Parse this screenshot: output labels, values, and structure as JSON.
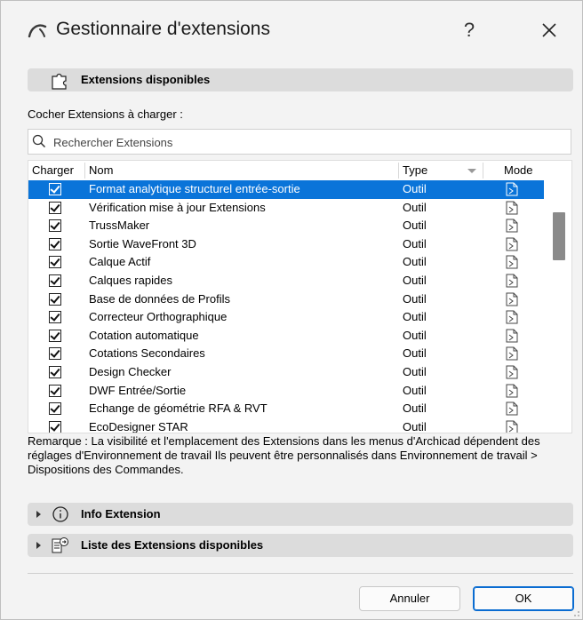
{
  "window": {
    "title": "Gestionnaire d'extensions",
    "help_label": "?",
    "title_icon": "archicad-logo-icon",
    "close_icon": "close-icon"
  },
  "available_section": {
    "label": "Extensions disponibles",
    "icon": "puzzle-piece-icon"
  },
  "prompt": "Cocher Extensions à charger :",
  "search": {
    "placeholder": "Rechercher Extensions",
    "value": "",
    "icon": "search-icon"
  },
  "table": {
    "columns": [
      "Charger",
      "Nom",
      "Type",
      "Mode"
    ],
    "rows": [
      {
        "checked": true,
        "name": "Format analytique structurel entrée-sortie",
        "type": "Outil",
        "selected": true
      },
      {
        "checked": true,
        "name": "Vérification mise à jour Extensions",
        "type": "Outil"
      },
      {
        "checked": true,
        "name": "TrussMaker",
        "type": "Outil"
      },
      {
        "checked": true,
        "name": "Sortie WaveFront 3D",
        "type": "Outil"
      },
      {
        "checked": true,
        "name": "Calque Actif",
        "type": "Outil"
      },
      {
        "checked": true,
        "name": "Calques rapides",
        "type": "Outil"
      },
      {
        "checked": true,
        "name": "Base de données de Profils",
        "type": "Outil"
      },
      {
        "checked": true,
        "name": "Correcteur Orthographique",
        "type": "Outil"
      },
      {
        "checked": true,
        "name": "Cotation automatique",
        "type": "Outil"
      },
      {
        "checked": true,
        "name": "Cotations Secondaires",
        "type": "Outil"
      },
      {
        "checked": true,
        "name": "Design Checker",
        "type": "Outil"
      },
      {
        "checked": true,
        "name": "DWF Entrée/Sortie",
        "type": "Outil"
      },
      {
        "checked": true,
        "name": "Echange de géométrie RFA & RVT",
        "type": "Outil"
      },
      {
        "checked": true,
        "name": "EcoDesigner STAR",
        "type": "Outil"
      }
    ],
    "mode_icon": "document-arrow-icon",
    "selection_color": "#0a74d9"
  },
  "remark": "Remarque : La visibilité et l'emplacement des Extensions dans les menus d'Archicad dépendent des réglages d'Environnement de travail Ils peuvent être personnalisés dans Environnement de travail > Dispositions des Commandes.",
  "expanders": {
    "info": {
      "label": "Info Extension",
      "icon": "info-circle-icon"
    },
    "list": {
      "label": "Liste des Extensions disponibles",
      "icon": "export-list-icon"
    }
  },
  "buttons": {
    "cancel": "Annuler",
    "ok": "OK"
  },
  "colors": {
    "accent": "#0a6cd1",
    "section_bg": "#dcdcdc",
    "window_bg": "#f3f3f3"
  }
}
